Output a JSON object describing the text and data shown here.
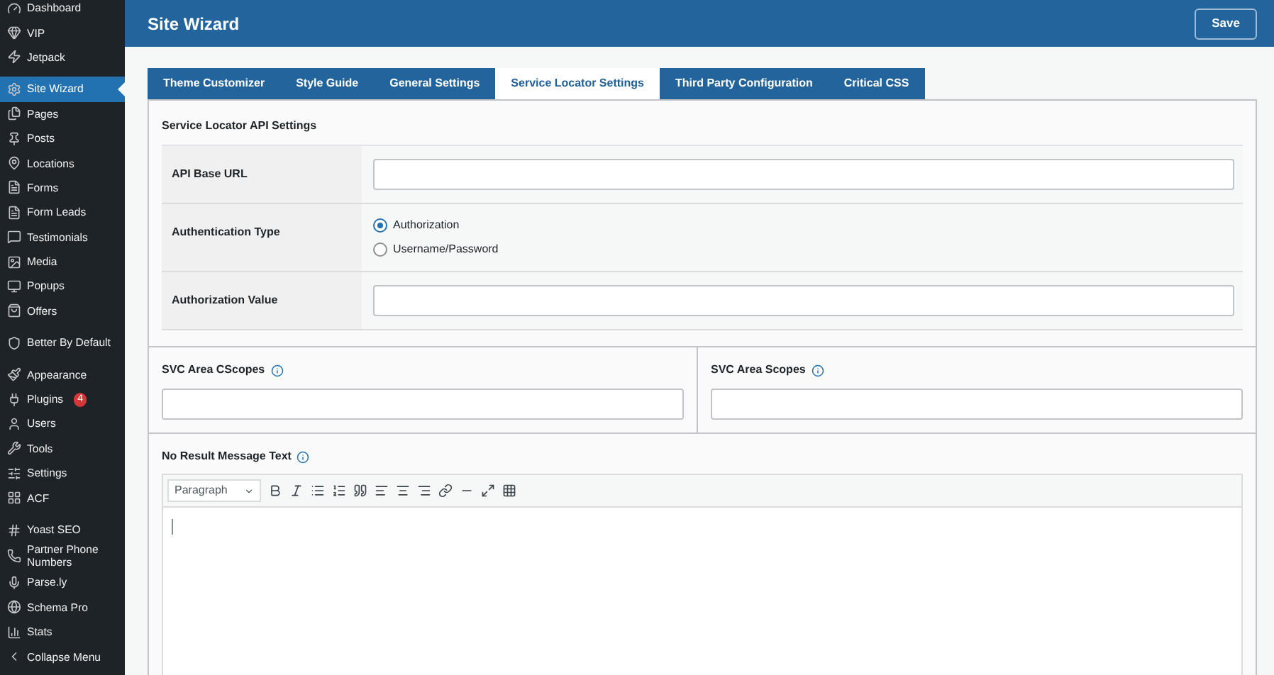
{
  "sidebar": {
    "groups": [
      {
        "items": [
          {
            "label": "Dashboard",
            "selected": false
          },
          {
            "label": "VIP",
            "selected": false
          },
          {
            "label": "Jetpack",
            "selected": false
          }
        ]
      },
      {
        "items": [
          {
            "label": "Site Wizard",
            "selected": true
          },
          {
            "label": "Pages",
            "selected": false
          },
          {
            "label": "Posts",
            "selected": false
          },
          {
            "label": "Locations",
            "selected": false
          },
          {
            "label": "Forms",
            "selected": false
          },
          {
            "label": "Form Leads",
            "selected": false
          },
          {
            "label": "Testimonials",
            "selected": false
          },
          {
            "label": "Media",
            "selected": false
          },
          {
            "label": "Popups",
            "selected": false
          },
          {
            "label": "Offers",
            "selected": false
          }
        ]
      },
      {
        "items": [
          {
            "label": "Better By Default",
            "selected": false
          }
        ]
      },
      {
        "items": [
          {
            "label": "Appearance",
            "selected": false
          },
          {
            "label": "Plugins",
            "selected": false,
            "badge": "4"
          },
          {
            "label": "Users",
            "selected": false
          },
          {
            "label": "Tools",
            "selected": false
          },
          {
            "label": "Settings",
            "selected": false
          },
          {
            "label": "ACF",
            "selected": false
          }
        ]
      },
      {
        "items": [
          {
            "label": "Yoast SEO",
            "selected": false
          },
          {
            "label": "Partner Phone Numbers",
            "selected": false
          },
          {
            "label": "Parse.ly",
            "selected": false
          },
          {
            "label": "Schema Pro",
            "selected": false
          },
          {
            "label": "Stats",
            "selected": false
          },
          {
            "label": "Collapse Menu",
            "selected": false
          }
        ]
      }
    ]
  },
  "header": {
    "title": "Site Wizard",
    "save_button": "Save"
  },
  "tabs": [
    {
      "label": "Theme Customizer",
      "selected": false
    },
    {
      "label": "Style Guide",
      "selected": false
    },
    {
      "label": "General Settings",
      "selected": false
    },
    {
      "label": "Service Locator Settings",
      "selected": true
    },
    {
      "label": "Third Party Configuration",
      "selected": false
    },
    {
      "label": "Critical CSS",
      "selected": false
    }
  ],
  "api_settings": {
    "title": "Service Locator API Settings",
    "rows": [
      {
        "kind": "text",
        "label": "API Base URL"
      },
      {
        "kind": "radio",
        "label": "Authentication Type",
        "options": [
          {
            "label": "Authorization",
            "selected": true
          },
          {
            "label": "Username/Password",
            "selected": false
          }
        ]
      },
      {
        "kind": "text",
        "label": "Authorization Value"
      }
    ]
  },
  "scope_fields": [
    {
      "label": "SVC Area CScopes"
    },
    {
      "label": "SVC Area Scopes"
    }
  ],
  "message_editor": {
    "label": "No Result Message Text",
    "format": "Paragraph"
  }
}
